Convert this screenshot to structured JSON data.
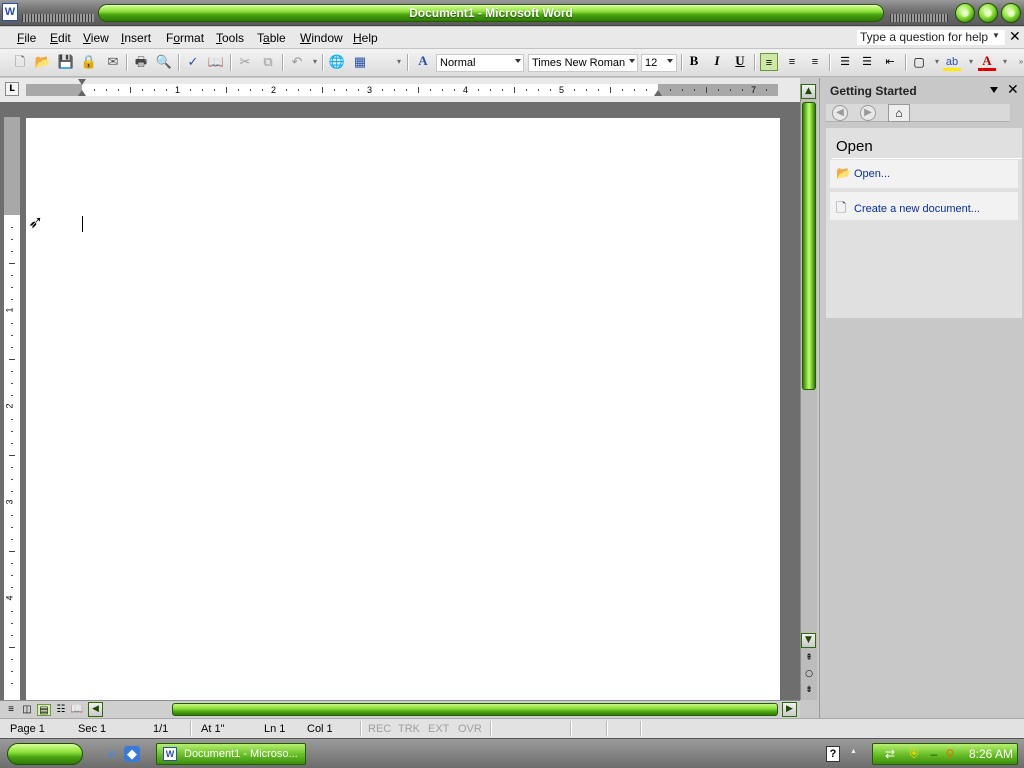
{
  "window": {
    "title": "Document1 - Microsoft Word",
    "app_icon": "W"
  },
  "menubar": {
    "items": [
      {
        "label": "File",
        "key": "F"
      },
      {
        "label": "Edit",
        "key": "E"
      },
      {
        "label": "View",
        "key": "V"
      },
      {
        "label": "Insert",
        "key": "I"
      },
      {
        "label": "Format",
        "key": "o"
      },
      {
        "label": "Tools",
        "key": "T"
      },
      {
        "label": "Table",
        "key": "a"
      },
      {
        "label": "Window",
        "key": "W"
      },
      {
        "label": "Help",
        "key": "H"
      }
    ],
    "help_placeholder": "Type a question for help",
    "close_glyph": "✕"
  },
  "toolbar": {
    "style": "Normal",
    "font": "Times New Roman",
    "size": "12",
    "bold": "B",
    "italic": "I",
    "underline": "U",
    "font_color_glyph": "A",
    "styles_glyph": "A"
  },
  "ruler": {
    "tab_glyph": "L",
    "numbers": [
      "1",
      "2",
      "3",
      "4",
      "5",
      "7"
    ],
    "vertical_numbers": [
      "1",
      "2",
      "3",
      "4"
    ]
  },
  "taskpane": {
    "title": "Getting Started",
    "close_glyph": "✕",
    "section_heading": "Open",
    "links": [
      "Open...",
      "Create a new document..."
    ]
  },
  "statusbar": {
    "page": "Page 1",
    "sec": "Sec 1",
    "pages": "1/1",
    "at": "At 1\"",
    "ln": "Ln 1",
    "col": "Col 1",
    "modes": [
      "REC",
      "TRK",
      "EXT",
      "OVR"
    ]
  },
  "taskbar": {
    "task_label": "Document1 - Microso...",
    "clock": "8:26 AM"
  },
  "colors": {
    "accent_green": "#8ee23a",
    "dark_green": "#2f7a08",
    "link_blue": "#0a2f9a"
  }
}
